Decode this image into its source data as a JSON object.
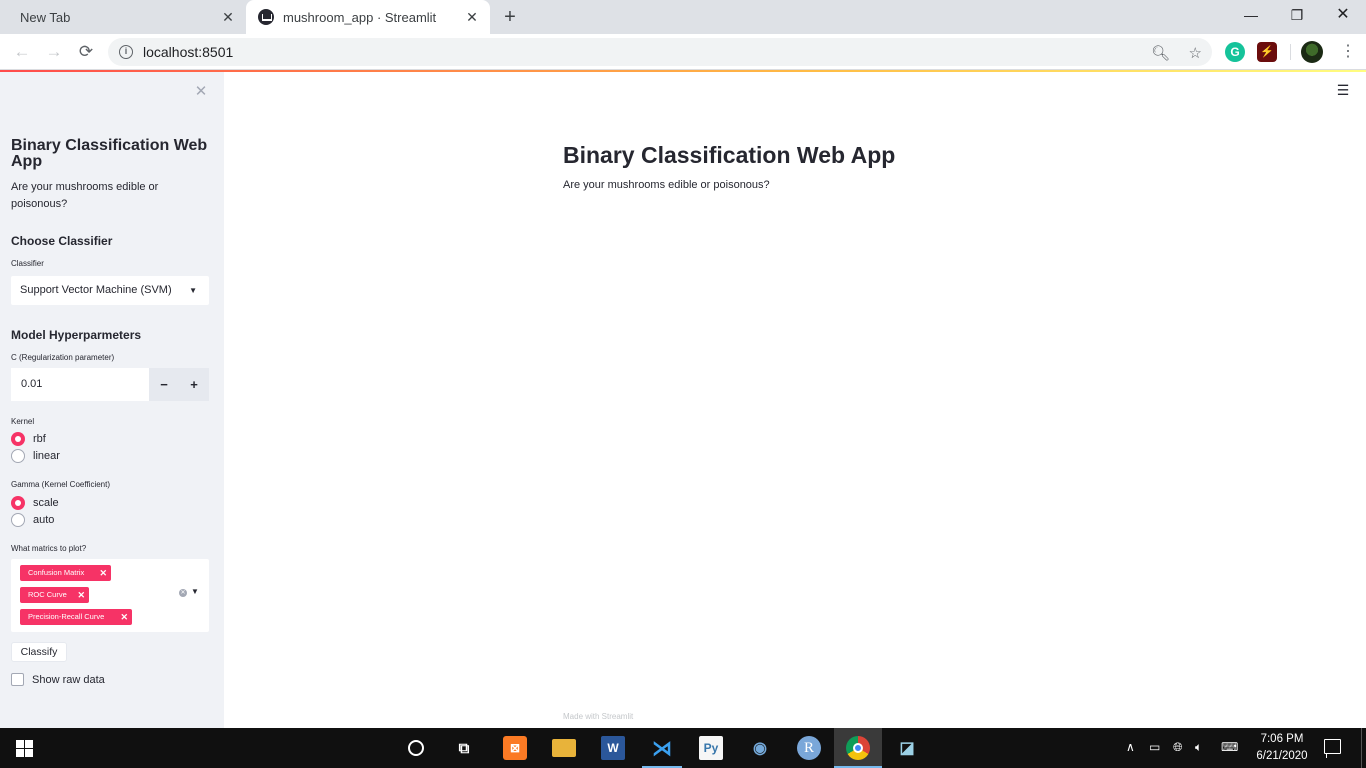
{
  "browser": {
    "tabs": [
      {
        "label": "New Tab",
        "active": false
      },
      {
        "label": "mushroom_app · Streamlit",
        "active": true
      }
    ],
    "close_glyph": "✕",
    "new_tab_glyph": "+",
    "window_controls": {
      "minimize": "—",
      "maximize": "❐",
      "close": "✕"
    },
    "url": "localhost:8501",
    "nav": {
      "back": "←",
      "forward": "→",
      "reload": "⟳"
    },
    "icons": [
      "zoom-out-icon",
      "star-icon",
      "grammarly-icon",
      "acrobat-icon",
      "profile-avatar",
      "menu-icon"
    ]
  },
  "sidebar": {
    "close_glyph": "✕",
    "title": "Binary Classification Web App",
    "description": "Are your mushrooms edible or poisonous?",
    "choose_classifier_heading": "Choose Classifier",
    "classifier_label": "Classifier",
    "classifier_value": "Support Vector Machine (SVM)",
    "hyperparams_heading": "Model Hyperparmeters",
    "c_label": "C (Regularization parameter)",
    "c_value": "0.01",
    "minus": "−",
    "plus": "+",
    "kernel_label": "Kernel",
    "kernel_options": [
      {
        "label": "rbf",
        "selected": true
      },
      {
        "label": "linear",
        "selected": false
      }
    ],
    "gamma_label": "Gamma (Kernel Coefficient)",
    "gamma_options": [
      {
        "label": "scale",
        "selected": true
      },
      {
        "label": "auto",
        "selected": false
      }
    ],
    "metrics_label": "What matrics to plot?",
    "metrics_selected": [
      "Confusion Matrix",
      "ROC Curve",
      "Precision-Recall Curve"
    ],
    "chip_remove": "✕",
    "classify_button": "Classify",
    "show_raw_label": "Show raw data",
    "show_raw_checked": false
  },
  "main": {
    "menu_glyph": "☰",
    "title": "Binary Classification Web App",
    "description": "Are your mushrooms edible or poisonous?",
    "footer": "Made with Streamlit"
  },
  "taskbar": {
    "time": "7:06 PM",
    "date": "6/21/2020",
    "apps": [
      "cortana",
      "task-view",
      "xampp",
      "file-explorer",
      "word",
      "vscode",
      "python",
      "rstudio",
      "r",
      "chrome",
      "snipping"
    ]
  },
  "colors": {
    "accent": "#f63366",
    "sidebar_bg": "#f0f2f6",
    "text": "#262730"
  }
}
